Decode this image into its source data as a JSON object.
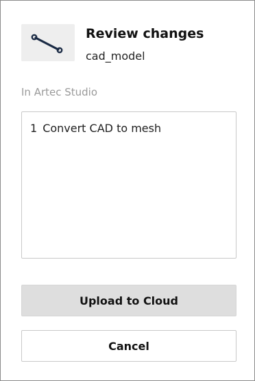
{
  "dialog": {
    "title": "Review changes",
    "model_name": "cad_model",
    "thumbnail_icon": "wrench-icon"
  },
  "changes_section": {
    "label": "In Artec Studio",
    "items": [
      {
        "number": "1",
        "text": "Convert CAD to mesh"
      }
    ]
  },
  "actions": {
    "upload_label": "Upload to Cloud",
    "cancel_label": "Cancel"
  },
  "colors": {
    "primary_button_bg": "#dedede",
    "secondary_button_bg": "#ffffff",
    "muted_text": "#9a9a9a",
    "border": "#c8c8c8",
    "icon": "#1a2a44"
  }
}
